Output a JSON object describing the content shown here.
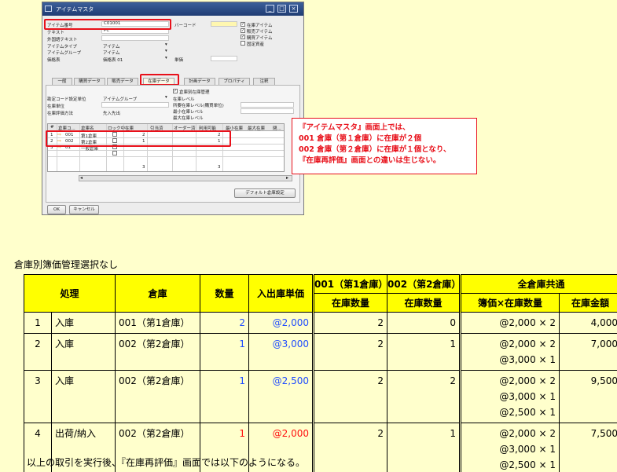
{
  "window": {
    "title": "アイテムマスタ",
    "header_fields": [
      {
        "label": "アイテム番号",
        "value": "C01001"
      },
      {
        "label": "テキスト",
        "value": "PC"
      },
      {
        "label": "外国語テキスト",
        "value": ""
      },
      {
        "label": "アイテムタイプ",
        "value": "アイテム"
      },
      {
        "label": "アイテムグループ",
        "value": "アイテム"
      },
      {
        "label": "価格表",
        "value": "価格表 01"
      }
    ],
    "barcode_label": "バーコード",
    "unit_price_label": "単価",
    "checkboxes": [
      {
        "label": "在庫アイテム",
        "checked": true
      },
      {
        "label": "販売アイテム",
        "checked": true
      },
      {
        "label": "購買アイテム",
        "checked": true
      },
      {
        "label": "固定資産",
        "checked": false
      }
    ],
    "tabs": [
      "一般",
      "購買データ",
      "販売データ",
      "在庫データ",
      "計画データ",
      "プロパティ",
      "注釈"
    ],
    "active_tab": "在庫データ",
    "inventory": {
      "warehouse_check_label": "倉庫別在庫管理",
      "default_gl_label": "勘定コード設定単位",
      "default_gl_value": "アイテムグループ",
      "inventory_uom_label": "在庫単位",
      "valuation_label": "在庫評価方法",
      "valuation_value": "先入先出",
      "levels": [
        "在庫レベル",
        "所要在庫レベル(購買単位)",
        "最小在庫レベル",
        "最大在庫レベル"
      ]
    },
    "grid": {
      "columns": [
        "#",
        "倉庫コ...",
        "倉庫名",
        "ロック中",
        "在庫",
        "引当済",
        "オーダー済",
        "利用可能",
        "最小在庫",
        "最大在庫",
        "閉..."
      ],
      "rows": [
        {
          "num": "1",
          "code": "001",
          "name": "第1倉庫",
          "in_stock": "2",
          "available": "2"
        },
        {
          "num": "2",
          "code": "002",
          "name": "第2倉庫",
          "in_stock": "1",
          "available": "1"
        },
        {
          "num": "3",
          "code": "01",
          "name": "一般倉庫",
          "in_stock": "",
          "available": ""
        }
      ],
      "totals": {
        "in_stock": "3",
        "available": "3"
      }
    },
    "default_wh_button": "デフォルト倉庫設定",
    "ok_button": "OK",
    "cancel_button": "キャンセル"
  },
  "callout": {
    "lines": [
      "『アイテムマスタ』画面上では、",
      "001 倉庫（第１倉庫）に在庫が２個",
      "002 倉庫（第２倉庫）に在庫が１個となり、",
      "『在庫再評価』画面との違いは生じない。"
    ]
  },
  "heading": "倉庫別簿価管理選択なし",
  "table": {
    "headers": {
      "process": "処理",
      "warehouse": "倉庫",
      "qty": "数量",
      "price": "入出庫単価",
      "wh001": "001（第1倉庫）",
      "wh002": "002（第2倉庫）",
      "all": "全倉庫共通",
      "stock_qty": "在庫数量",
      "book_x_qty": "簿価×在庫数量",
      "stock_amount": "在庫金額"
    },
    "rows": [
      {
        "no": "1",
        "process": "入庫",
        "warehouse": "001（第1倉庫）",
        "qty": "2",
        "price": "@2,000",
        "s001": "2",
        "s002": "0",
        "book": [
          "@2,000 × 2"
        ],
        "amount": "4,000",
        "qty_color": "blue",
        "price_color": "blue"
      },
      {
        "no": "2",
        "process": "入庫",
        "warehouse": "002（第2倉庫）",
        "qty": "1",
        "price": "@3,000",
        "s001": "2",
        "s002": "1",
        "book": [
          "@2,000 × 2",
          "@3,000 × 1"
        ],
        "amount": "7,000",
        "qty_color": "blue",
        "price_color": "blue"
      },
      {
        "no": "3",
        "process": "入庫",
        "warehouse": "002（第2倉庫）",
        "qty": "1",
        "price": "@2,500",
        "s001": "2",
        "s002": "2",
        "book": [
          "@2,000 × 2",
          "@3,000 × 1",
          "@2,500 × 1"
        ],
        "amount": "9,500",
        "qty_color": "blue",
        "price_color": "blue"
      },
      {
        "no": "4",
        "process": "出荷/納入",
        "warehouse": "002（第2倉庫）",
        "qty": "1",
        "price": "@2,000",
        "s001": "2",
        "s002": "1",
        "book": [
          "@2,000 × 2",
          "@3,000 × 1",
          "@2,500 × 1"
        ],
        "amount": "7,500",
        "qty_color": "red",
        "price_color": "red"
      }
    ]
  },
  "footer": "以上の取引を実行後、『在庫再評価』画面では以下のようになる。"
}
